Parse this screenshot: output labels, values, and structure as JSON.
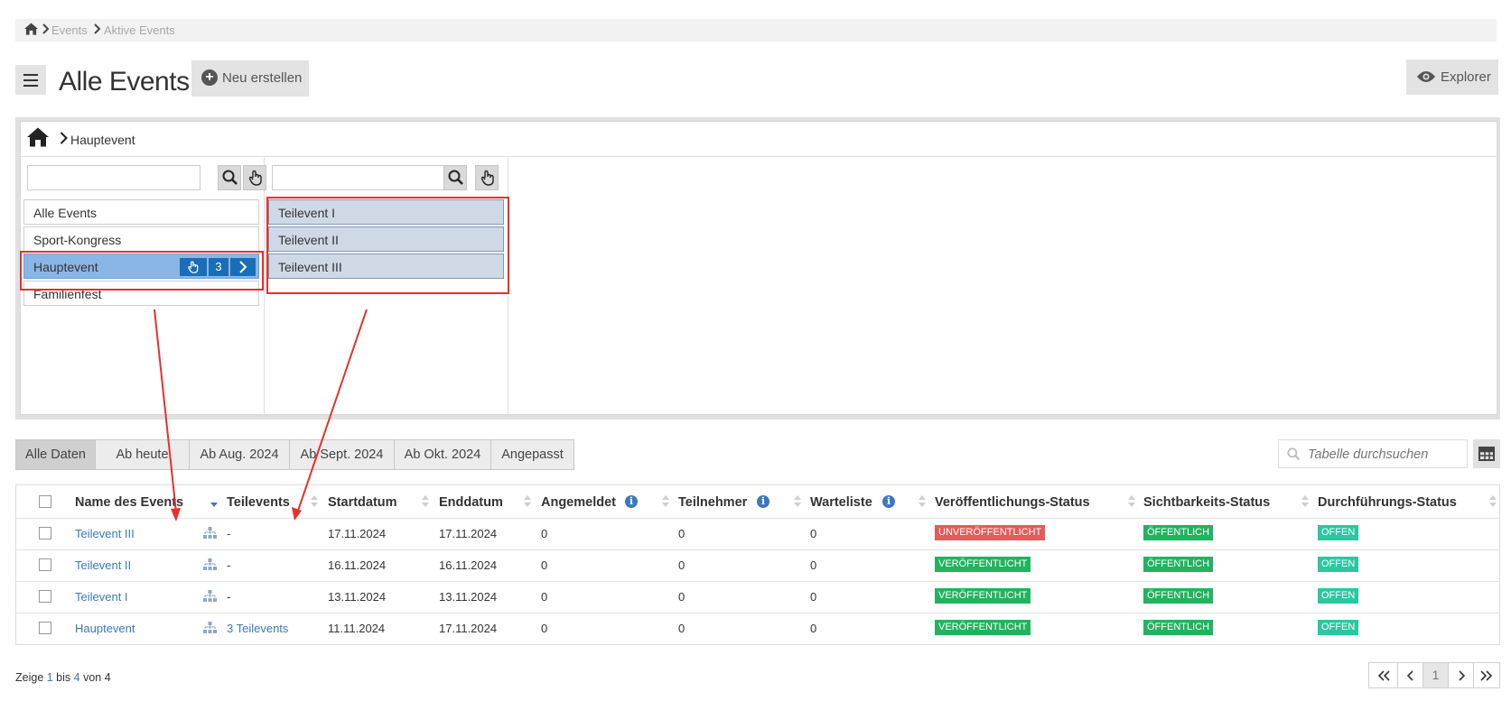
{
  "breadcrumb": {
    "items": [
      "Events",
      "Aktive Events"
    ]
  },
  "header": {
    "title": "Alle Events",
    "new_label": "Neu erstellen",
    "explorer_label": "Explorer"
  },
  "explorer": {
    "path": "Hauptevent",
    "col1": {
      "items": [
        "Alle Events",
        "Sport-Kongress",
        "Hauptevent",
        "Familienfest"
      ],
      "selected_count": "3"
    },
    "col2": {
      "items": [
        "Teilevent I",
        "Teilevent II",
        "Teilevent III"
      ]
    }
  },
  "filters": {
    "tabs": [
      "Alle Daten",
      "Ab heute",
      "Ab Aug. 2024",
      "Ab Sept. 2024",
      "Ab Okt. 2024",
      "Angepasst"
    ]
  },
  "search": {
    "placeholder": "Tabelle durchsuchen"
  },
  "table": {
    "headers": [
      "Name des Events",
      "Teilevents",
      "Startdatum",
      "Enddatum",
      "Angemeldet",
      "Teilnehmer",
      "Warteliste",
      "Veröffentlichungs-Status",
      "Sichtbarkeits-Status",
      "Durchführungs-Status"
    ],
    "rows": [
      {
        "name": "Teilevent III",
        "teilevents": "-",
        "start": "17.11.2024",
        "end": "17.11.2024",
        "angemeldet": "0",
        "teilnehmer": "0",
        "warteliste": "0",
        "pub": "UNVERÖFFENTLICHT",
        "vis": "ÖFFENTLICH",
        "exec": "OFFEN"
      },
      {
        "name": "Teilevent II",
        "teilevents": "-",
        "start": "16.11.2024",
        "end": "16.11.2024",
        "angemeldet": "0",
        "teilnehmer": "0",
        "warteliste": "0",
        "pub": "VERÖFFENTLICHT",
        "vis": "ÖFFENTLICH",
        "exec": "OFFEN"
      },
      {
        "name": "Teilevent I",
        "teilevents": "-",
        "start": "13.11.2024",
        "end": "13.11.2024",
        "angemeldet": "0",
        "teilnehmer": "0",
        "warteliste": "0",
        "pub": "VERÖFFENTLICHT",
        "vis": "ÖFFENTLICH",
        "exec": "OFFEN"
      },
      {
        "name": "Hauptevent",
        "teilevents": "3 Teilevents",
        "start": "11.11.2024",
        "end": "17.11.2024",
        "angemeldet": "0",
        "teilnehmer": "0",
        "warteliste": "0",
        "pub": "VERÖFFENTLICHT",
        "vis": "ÖFFENTLICH",
        "exec": "OFFEN"
      }
    ]
  },
  "footer": {
    "summary_prefix": "Zeige ",
    "summary_from": "1",
    "summary_mid": " bis ",
    "summary_to": "4",
    "summary_suffix": " von 4",
    "current_page": "1"
  },
  "colors": {
    "link": "#3b78c3",
    "selected": "#8ab6e6",
    "red_badge": "#e35d5a",
    "green_badge": "#22b35f",
    "teal_badge": "#2cc79f",
    "annotation": "#e8302c"
  }
}
